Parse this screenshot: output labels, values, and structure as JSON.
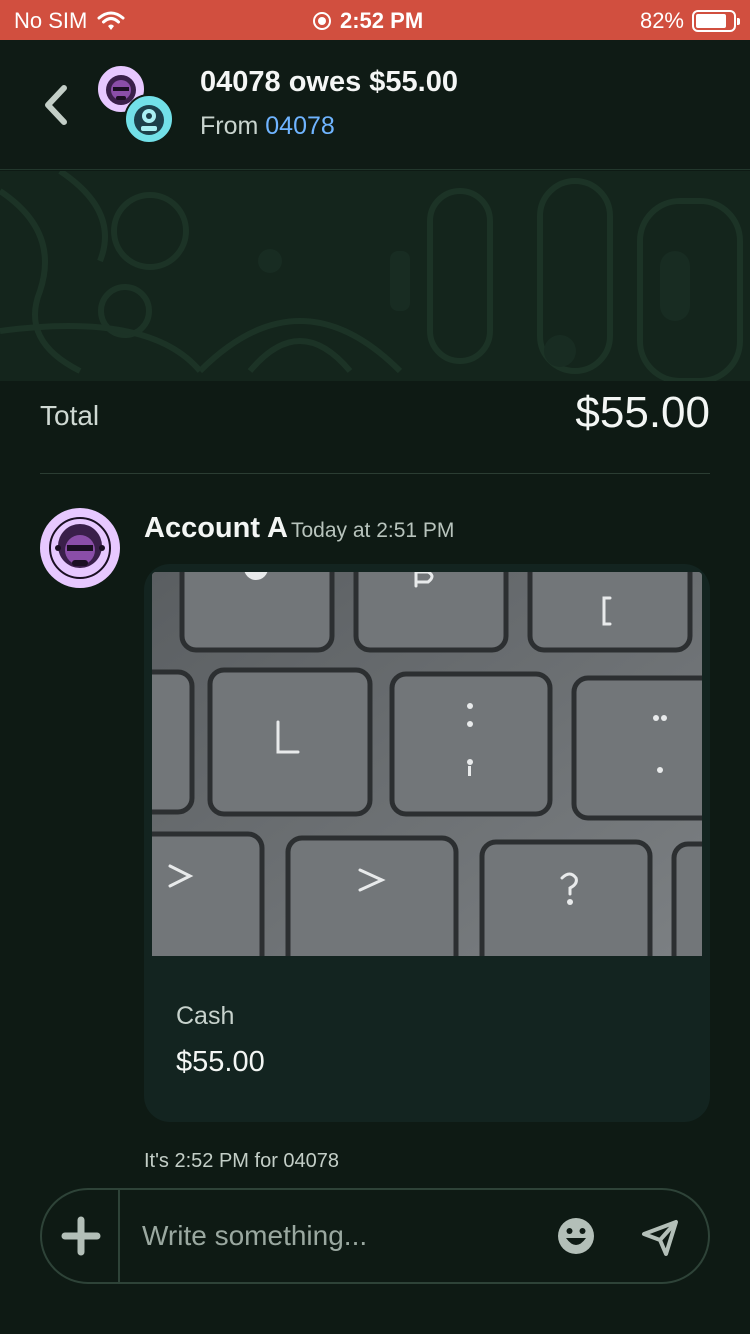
{
  "status_bar": {
    "carrier": "No SIM",
    "time": "2:52 PM",
    "battery": "82%",
    "battery_level": 0.82
  },
  "header": {
    "title": "04078 owes $55.00",
    "from_label": "From",
    "from_link": "04078"
  },
  "total": {
    "label": "Total",
    "value": "$55.00"
  },
  "message": {
    "author": "Account A",
    "time": "Today at 2:51 PM",
    "card": {
      "payment_method": "Cash",
      "amount": "$55.00"
    }
  },
  "time_note": "It's 2:52 PM for 04078",
  "compose": {
    "placeholder": "Write something..."
  },
  "colors": {
    "status_bar": "#d14f3f",
    "background": "#0e1a14",
    "card": "#132420",
    "link": "#6fb4ff",
    "avatar_a": "#e7c8ff",
    "avatar_b": "#72e0e8"
  },
  "icons": [
    "wifi-icon",
    "location-icon",
    "battery-icon",
    "back-icon",
    "plus-icon",
    "emoji-icon",
    "send-icon"
  ]
}
